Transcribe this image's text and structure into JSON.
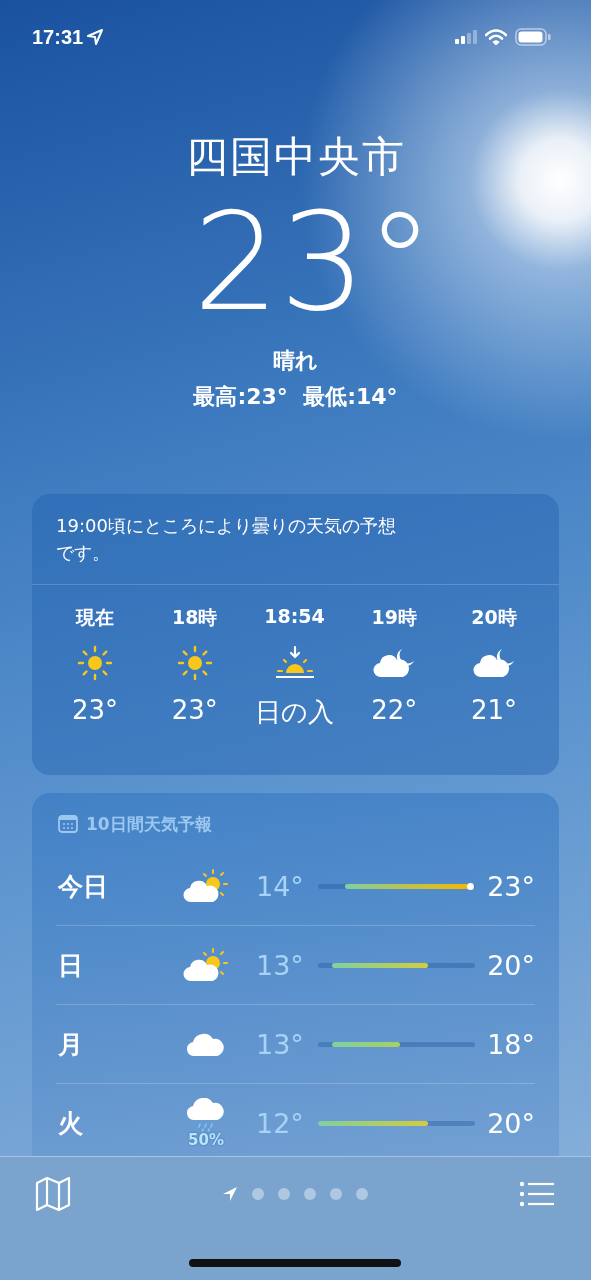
{
  "status_bar": {
    "time": "17:31"
  },
  "location": {
    "city": "四国中央市",
    "temperature": "23°",
    "condition": "晴れ",
    "high_low": "最高:23°  最低:14°"
  },
  "hourly": {
    "summary": "19:00頃にところにより曇りの天気の予想です。",
    "hours": [
      {
        "label": "現在",
        "kind": "sun",
        "value": "23°"
      },
      {
        "label": "18時",
        "kind": "sun",
        "value": "23°"
      },
      {
        "label": "18:54",
        "kind": "sunset",
        "value": "日の入"
      },
      {
        "label": "19時",
        "kind": "cloud-moon",
        "value": "22°"
      },
      {
        "label": "20時",
        "kind": "cloud-moon",
        "value": "21°"
      }
    ]
  },
  "forecast": {
    "title": "10日間天気予報",
    "days": [
      {
        "day": "今日",
        "kind": "partly-sunny",
        "low": "14°",
        "high": "23°",
        "now": true
      },
      {
        "day": "日",
        "kind": "partly-sunny",
        "low": "13°",
        "high": "20°",
        "now": false
      },
      {
        "day": "月",
        "kind": "cloud",
        "low": "13°",
        "high": "18°",
        "now": false
      },
      {
        "day": "火",
        "kind": "rain",
        "precipitation": "50%",
        "low": "12°",
        "high": "20°",
        "now": false
      }
    ]
  },
  "pages": [
    {
      "kind": "location",
      "selected": true
    },
    {
      "kind": "dot",
      "selected": false
    },
    {
      "kind": "dot",
      "selected": false
    },
    {
      "kind": "dot",
      "selected": false
    },
    {
      "kind": "dot",
      "selected": false
    },
    {
      "kind": "dot",
      "selected": false
    }
  ]
}
